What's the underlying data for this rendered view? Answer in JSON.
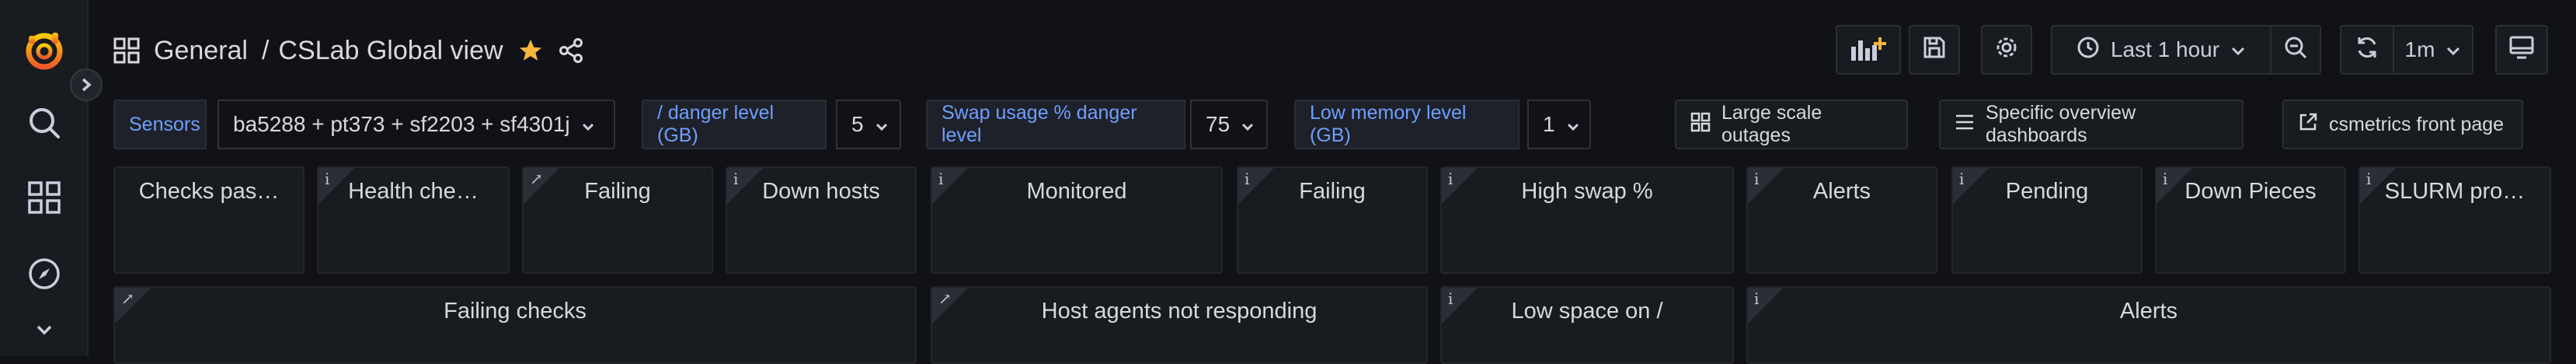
{
  "colors": {
    "accent": "#f5b73b",
    "link": "#6e9fff",
    "bg": "#111217"
  },
  "breadcrumb": {
    "folder": "General",
    "separator": "/",
    "dashboard": "CSLab Global view"
  },
  "toolbar": {
    "time_range": "Last 1 hour",
    "refresh_interval": "1m"
  },
  "variables": [
    {
      "label": "Sensors",
      "value": "ba5288 + pt373 + sf2203 + sf4301j"
    },
    {
      "label": "/ danger level (GB)",
      "value": "5"
    },
    {
      "label": "Swap usage % danger level",
      "value": "75"
    },
    {
      "label": "Low memory level (GB)",
      "value": "1"
    }
  ],
  "links": [
    {
      "label": "Large scale outages",
      "icon": "apps-icon"
    },
    {
      "label": "Specific overview dashboards",
      "icon": "bars-icon"
    },
    {
      "label": "csmetrics front page",
      "icon": "external-link-icon"
    }
  ],
  "stat_panels": [
    {
      "title": "Checks pas…",
      "corner": "none"
    },
    {
      "title": "Health che…",
      "corner": "info"
    },
    {
      "title": "Failing",
      "corner": "link"
    },
    {
      "title": "Down hosts",
      "corner": "info"
    },
    {
      "title": "Monitored",
      "corner": "info"
    },
    {
      "title": "Failing",
      "corner": "info"
    },
    {
      "title": "High swap %",
      "corner": "info"
    },
    {
      "title": "Alerts",
      "corner": "info"
    },
    {
      "title": "Pending",
      "corner": "info"
    },
    {
      "title": "Down Pieces",
      "corner": "info"
    },
    {
      "title": "SLURM pro…",
      "corner": "info"
    }
  ],
  "table_panels": [
    {
      "title": "Failing checks",
      "corner": "link"
    },
    {
      "title": "Host agents not responding",
      "corner": "link"
    },
    {
      "title": "Low space on /",
      "corner": "info"
    },
    {
      "title": "Alerts",
      "corner": "info"
    }
  ]
}
